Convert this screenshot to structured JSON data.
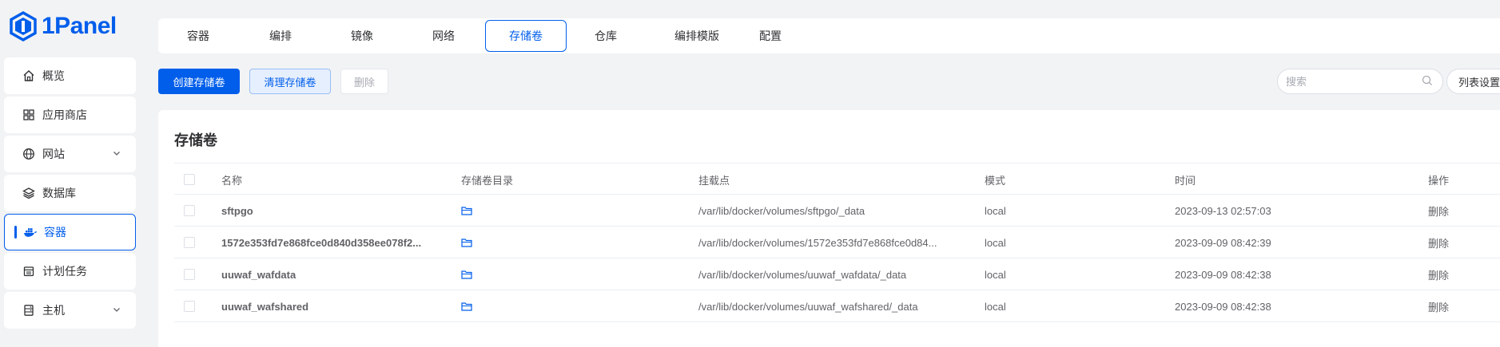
{
  "app": {
    "logo_text": "1Panel"
  },
  "sidebar": {
    "items": [
      {
        "label": "概览",
        "icon": "home-icon"
      },
      {
        "label": "应用商店",
        "icon": "grid-icon"
      },
      {
        "label": "网站",
        "icon": "globe-icon",
        "expandable": true
      },
      {
        "label": "数据库",
        "icon": "layers-icon"
      },
      {
        "label": "容器",
        "icon": "docker-icon",
        "active": true
      },
      {
        "label": "计划任务",
        "icon": "calendar-icon"
      },
      {
        "label": "主机",
        "icon": "server-icon",
        "expandable": true
      }
    ]
  },
  "tabs": [
    {
      "label": "容器"
    },
    {
      "label": "编排"
    },
    {
      "label": "镜像"
    },
    {
      "label": "网络"
    },
    {
      "label": "存储卷",
      "active": true
    },
    {
      "label": "仓库"
    },
    {
      "label": "编排模版"
    },
    {
      "label": "配置"
    }
  ],
  "toolbar": {
    "create_label": "创建存储卷",
    "prune_label": "清理存储卷",
    "delete_label": "删除",
    "search_placeholder": "搜索",
    "column_settings_label": "列表设置"
  },
  "card": {
    "title": "存储卷"
  },
  "table": {
    "columns": [
      "名称",
      "存储卷目录",
      "挂载点",
      "模式",
      "时间",
      "操作"
    ],
    "rows": [
      {
        "name": "sftpgo",
        "mountpoint": "/var/lib/docker/volumes/sftpgo/_data",
        "driver": "local",
        "time": "2023-09-13 02:57:03",
        "action": "删除"
      },
      {
        "name": "1572e353fd7e868fce0d840d358ee078f2...",
        "mountpoint": "/var/lib/docker/volumes/1572e353fd7e868fce0d84...",
        "driver": "local",
        "time": "2023-09-09 08:42:39",
        "action": "删除"
      },
      {
        "name": "uuwaf_wafdata",
        "mountpoint": "/var/lib/docker/volumes/uuwaf_wafdata/_data",
        "driver": "local",
        "time": "2023-09-09 08:42:38",
        "action": "删除"
      },
      {
        "name": "uuwaf_wafshared",
        "mountpoint": "/var/lib/docker/volumes/uuwaf_wafshared/_data",
        "driver": "local",
        "time": "2023-09-09 08:42:38",
        "action": "删除"
      }
    ]
  },
  "colors": {
    "primary": "#005eeb",
    "background": "#f2f3f5"
  }
}
